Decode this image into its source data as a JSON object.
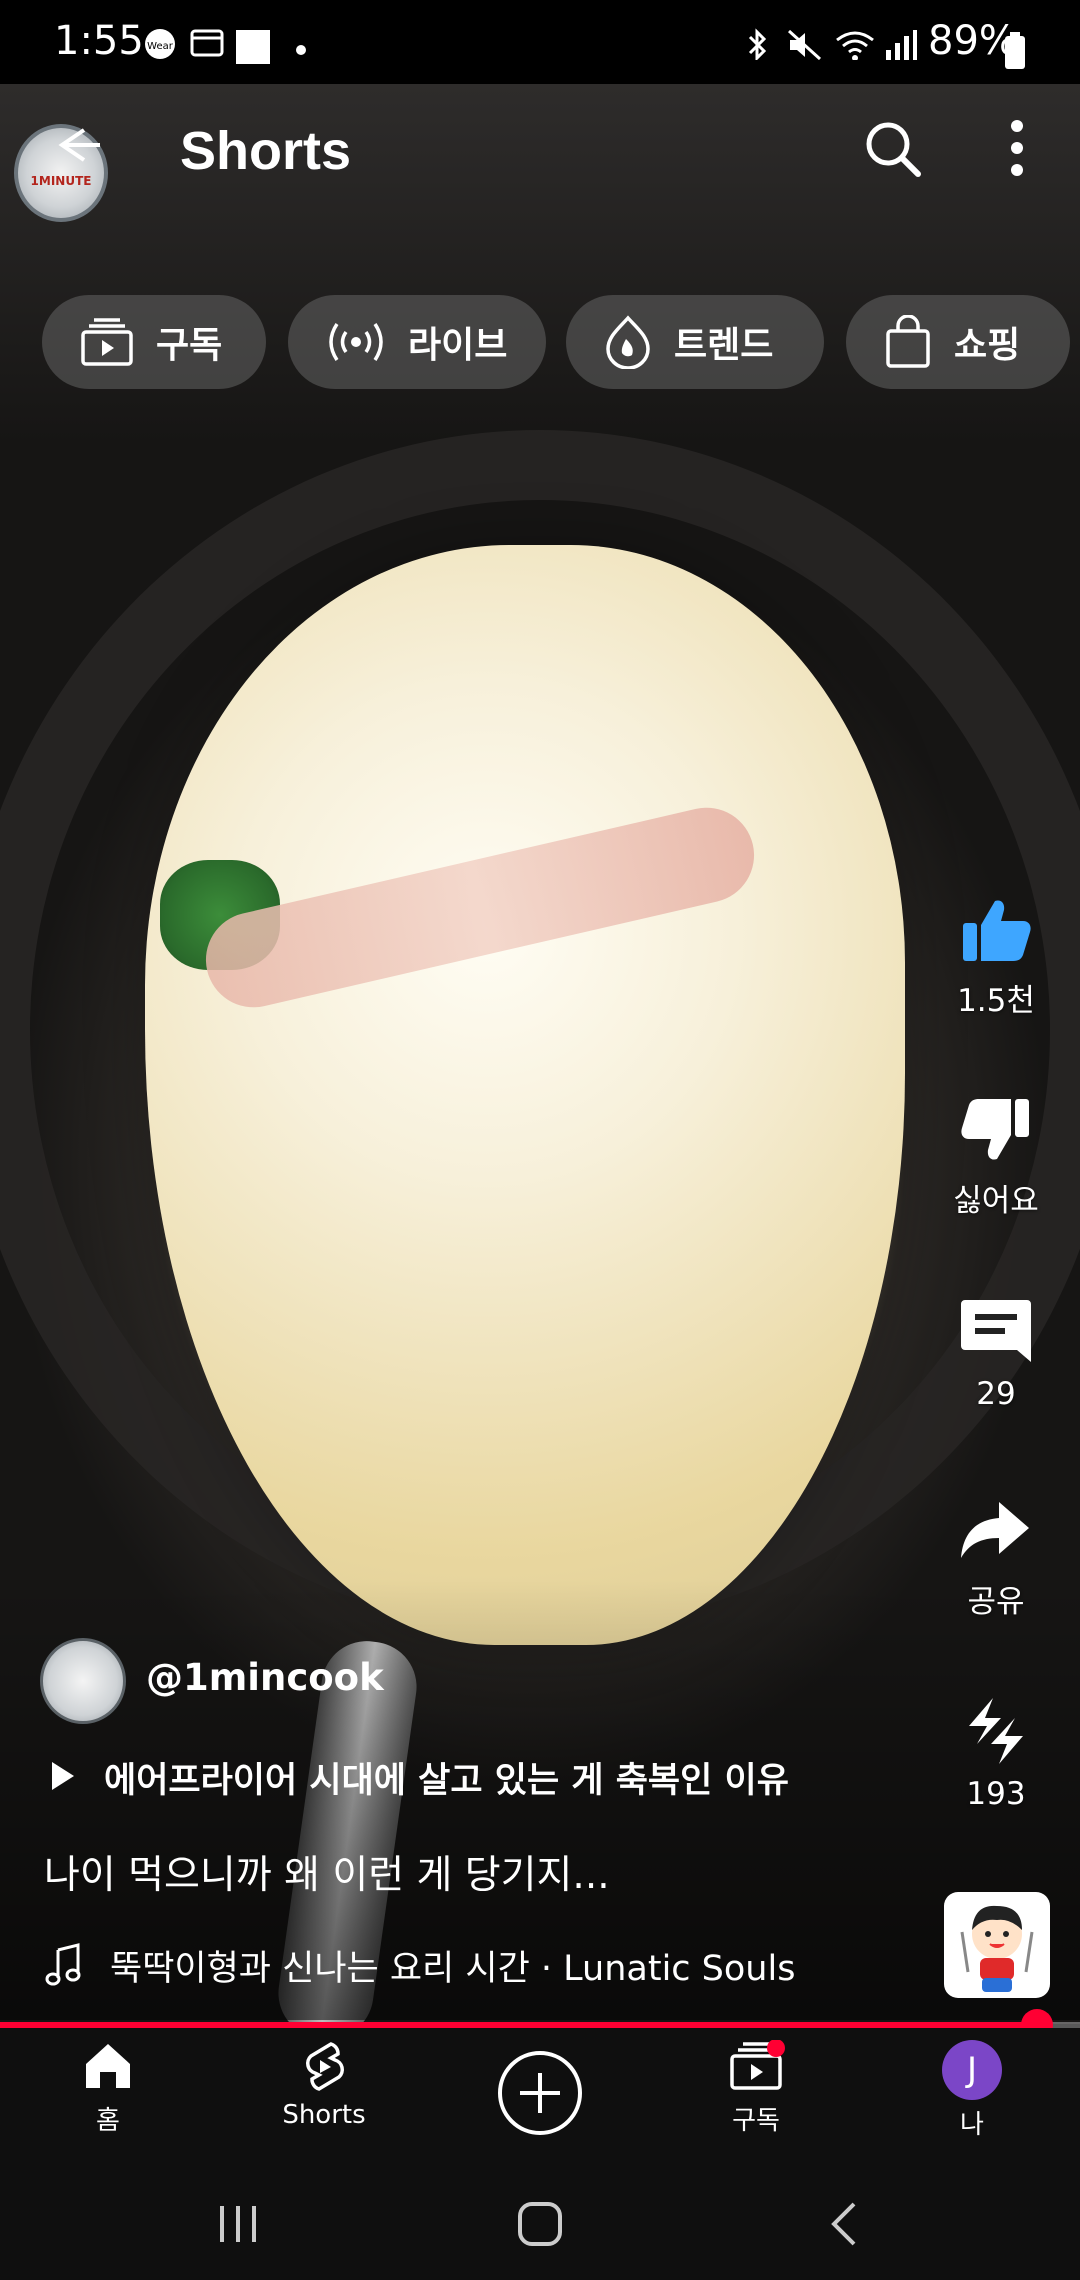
{
  "status_bar": {
    "time": "1:55",
    "battery": "89%"
  },
  "header": {
    "title": "Shorts",
    "logo_text": "1MINUTE"
  },
  "chips": [
    {
      "label": "구독",
      "icon": "subscriptions-icon"
    },
    {
      "label": "라이브",
      "icon": "live-icon"
    },
    {
      "label": "트렌드",
      "icon": "trending-flame-icon"
    },
    {
      "label": "쇼핑",
      "icon": "shopping-bag-icon"
    }
  ],
  "actions": {
    "like_count": "1.5천",
    "dislike_label": "싫어요",
    "comment_count": "29",
    "share_label": "공유",
    "remix_count": "193"
  },
  "video": {
    "channel": "@1mincook",
    "playlist_title": "에어프라이어 시대에 살고 있는 게 축복인 이유",
    "caption": "나이 먹으니까 왜 이런 게 당기지...",
    "music": "뚝딱이형과 신나는 요리 시간 · Lunatic Souls",
    "progress": 0.96
  },
  "nav": [
    {
      "label": "홈",
      "icon": "home-icon"
    },
    {
      "label": "Shorts",
      "icon": "shorts-icon"
    },
    {
      "label": "",
      "icon": "create-plus-icon"
    },
    {
      "label": "구독",
      "icon": "subscriptions-icon"
    },
    {
      "label": "나",
      "icon": "avatar"
    }
  ],
  "account_initial": "J",
  "colors": {
    "accent": "#ff0033",
    "like_blue": "#3ea6ff",
    "avatar_purple": "#7b46c7"
  }
}
